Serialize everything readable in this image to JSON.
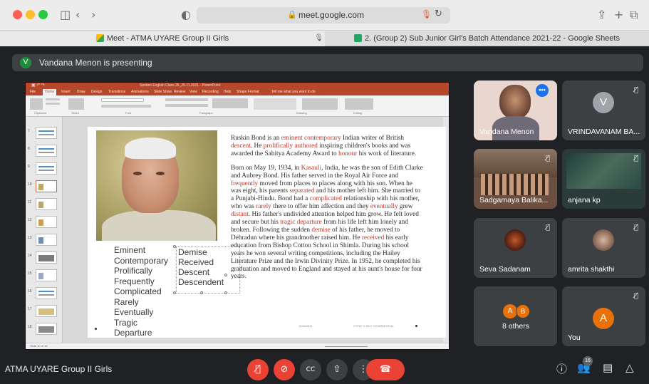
{
  "browser": {
    "url": "meet.google.com",
    "tabs": [
      {
        "label": "Meet - ATMA UYARE Group II Girls"
      },
      {
        "label": "2. (Group 2) Sub Junior Girl's Batch Attendance 2021-22 - Google Sheets"
      }
    ]
  },
  "presenting_banner": {
    "initial": "V",
    "text": "Vandana Menon is presenting"
  },
  "ppt": {
    "window_title": "Spoken English Class 26_26.11.2021 - PowerPoint",
    "menu": [
      "File",
      "Home",
      "Insert",
      "Draw",
      "Design",
      "Transitions",
      "Animations",
      "Slide Show",
      "Review",
      "View",
      "Recording",
      "Help",
      "Shape Format"
    ],
    "active_menu": "Home",
    "tell_me": "Tell me what you want to do",
    "ribbon_groups": [
      "Clipboard",
      "Slides",
      "Font",
      "Paragraph",
      "Drawing",
      "Editing"
    ],
    "thumb_numbers": [
      "7",
      "8",
      "9",
      "10",
      "11",
      "12",
      "13",
      "14",
      "15",
      "16",
      "17",
      "18"
    ],
    "status": "Slide 10 of 18",
    "slide": {
      "words_left": [
        "Eminent",
        "Contemporary",
        "Prolifically",
        "Frequently",
        "Complicated",
        "Rarely",
        "Eventually",
        "Tragic",
        "Departure"
      ],
      "words_right": [
        "Demise",
        "Received",
        "Descent",
        "Descendent"
      ],
      "p1": [
        {
          "t": "Ruskin Bond is an "
        },
        {
          "t": "eminent contemporary",
          "hl": true
        },
        {
          "t": " Indian writer of British "
        },
        {
          "t": "descent",
          "hl": true
        },
        {
          "t": ". He "
        },
        {
          "t": "prolifically authored",
          "hl": true
        },
        {
          "t": " inspiring children's books and was awarded the Sahitya Academy Award to "
        },
        {
          "t": "honour",
          "hl": true
        },
        {
          "t": " his work of literature."
        }
      ],
      "p2": [
        {
          "t": "Born on May 19, 1934, in "
        },
        {
          "t": "Kasauli",
          "hl": true
        },
        {
          "t": ", India, he was the son of Edith Clarke and Aubrey Bond. His father served in the Royal Air Force and "
        },
        {
          "t": "frequently",
          "hl": true
        },
        {
          "t": " moved from places to places along with his son. When he was eight, his parents "
        },
        {
          "t": "separated",
          "hl": true
        },
        {
          "t": " and his mother left him. She married to a Punjabi-Hindu. Bond had a "
        },
        {
          "t": "complicated",
          "hl": true
        },
        {
          "t": " relationship with his mother, who was "
        },
        {
          "t": "rarely",
          "hl": true
        },
        {
          "t": " there to offer him affection and they "
        },
        {
          "t": "eventually",
          "hl": true
        },
        {
          "t": " grew "
        },
        {
          "t": "distant",
          "hl": true
        },
        {
          "t": ". His father's undivided attention helped him grow. He felt loved and secure but his "
        },
        {
          "t": "tragic departure",
          "hl": true
        },
        {
          "t": " from his life left him lonely and broken. Following the sudden "
        },
        {
          "t": "demise",
          "hl": true
        },
        {
          "t": " of his father, he moved to Dehradun where his grandmother raised him. He "
        },
        {
          "t": "received",
          "hl": true
        },
        {
          "t": " his early education from Bishop Cotton School in Shimla. During his school years he won several writing competitions, including the Hailey Literature Prize and the Irwin Divinity Prize. In 1952, he completed his graduation and moved to England and stayed at his aunt's house for four years."
        }
      ],
      "footer_date": "11/26/2021",
      "footer_conf": "CYFAT © 2017 CONFIDENTIAL"
    }
  },
  "participants": [
    {
      "name": "Vandana Menon",
      "muted": false
    },
    {
      "name": "VRINDAVANAM BA...",
      "initial": "V",
      "muted": true
    },
    {
      "name": "Sadgamaya Balika...",
      "muted": true
    },
    {
      "name": "anjana kp",
      "muted": true
    },
    {
      "name": "Seva Sadanam",
      "muted": true
    },
    {
      "name": "amrita shakthi",
      "muted": true
    },
    {
      "name": "8 others",
      "initials": [
        "A",
        "B"
      ]
    },
    {
      "name": "You",
      "initial": "A",
      "muted": true
    }
  ],
  "meeting_name": "ATMA UYARE Group II Girls",
  "people_count": "16",
  "colors": {
    "accent_red": "#ea4335",
    "ppt_red": "#b7472a",
    "highlight": "#c0392b",
    "meet_bg": "#202124",
    "tile_bg": "#3c4043"
  }
}
